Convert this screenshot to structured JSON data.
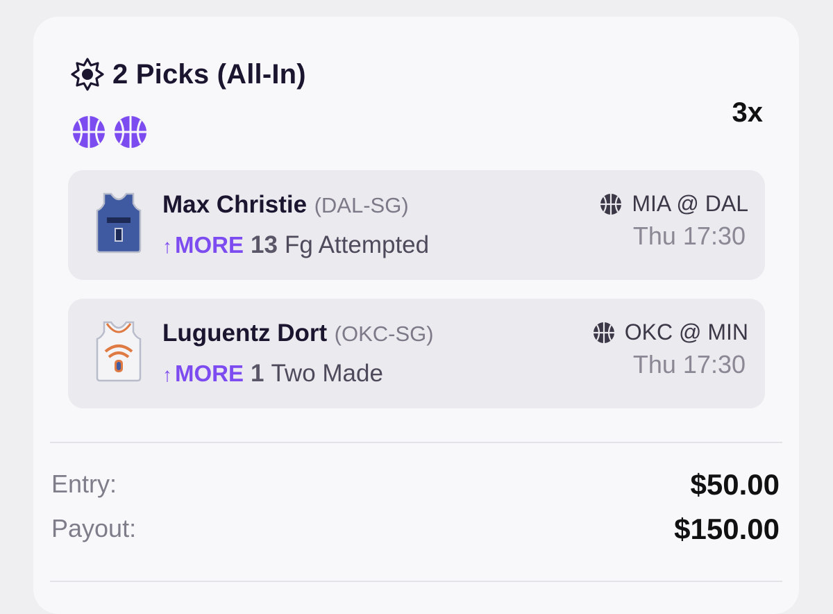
{
  "header": {
    "title": "2 Picks (All-In)",
    "multiplier": "3x",
    "icons": [
      "sun-icon",
      "basketball-icon",
      "basketball-icon"
    ]
  },
  "picks": [
    {
      "player": "Max Christie",
      "team_pos": "(DAL-SG)",
      "direction": "MORE",
      "line": "13",
      "stat": "Fg Attempted",
      "matchup": "MIA @ DAL",
      "time": "Thu 17:30",
      "jersey_color": "#3f5aa0"
    },
    {
      "player": "Luguentz Dort",
      "team_pos": "(OKC-SG)",
      "direction": "MORE",
      "line": "1",
      "stat": "Two Made",
      "matchup": "OKC @ MIN",
      "time": "Thu 17:30",
      "jersey_color": "#f4f4f6"
    }
  ],
  "summary": {
    "entry_label": "Entry:",
    "entry_value": "$50.00",
    "payout_label": "Payout:",
    "payout_value": "$150.00"
  },
  "colors": {
    "accent": "#7d4cf0",
    "background": "#efeef0",
    "card": "#f8f8fa",
    "pick_bg": "#ebeaee"
  }
}
